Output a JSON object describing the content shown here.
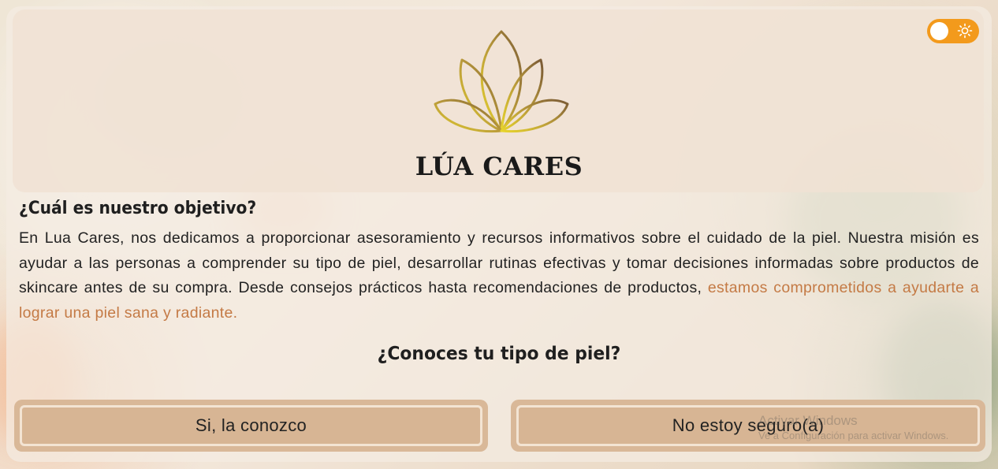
{
  "brand": {
    "name": "LÚA CARES",
    "logo_icon": "lotus-flower-icon"
  },
  "theme_toggle": {
    "state": "light",
    "icon": "sun-icon",
    "accent_color": "#f39a1c"
  },
  "objective": {
    "title": "¿Cuál es nuestro objetivo?",
    "text": "En Lua Cares, nos dedicamos a proporcionar asesoramiento y recursos informativos sobre el cuidado de la piel. Nuestra misión es ayudar a las personas a comprender su tipo de piel, desarrollar rutinas efectivas y tomar decisiones informadas sobre productos de skincare antes de su compra. Desde consejos prácticos hasta recomendaciones de productos, ",
    "highlight": "estamos comprometidos a ayudarte a lograr una piel sana y radiante.",
    "highlight_color": "#c47a45"
  },
  "question": {
    "text": "¿Conoces tu tipo de piel?"
  },
  "choices": {
    "yes_label": "Si, la conozco",
    "no_label": "No estoy seguro(a)"
  },
  "watermark": {
    "line1": "Activar Windows",
    "line2": "Ve a Configuración para activar Windows."
  }
}
